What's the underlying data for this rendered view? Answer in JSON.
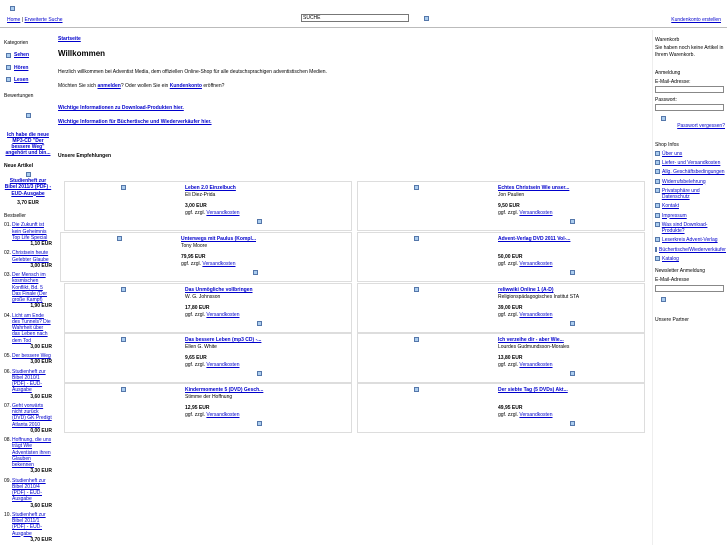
{
  "header": {
    "home": "Home",
    "advanced_search": "Erweiterte Suche",
    "search_value": "SUCHE",
    "customer_account": "Kundenkonto erstellen"
  },
  "left": {
    "categories_title": "Kategorien",
    "categories": [
      "Sehen",
      "Hören",
      "Lesen"
    ],
    "reviews_title": "Bewertungen",
    "review_text": "Ich habe die neue MP3-CD \"Der bessere Weg\" angehört und bin...",
    "new_title": "Neue Artikel",
    "new_item": "Studienheft zur Bibel 2011/3 (PDF) - EUD-Ausgabe",
    "new_price": "3,70 EUR",
    "bestseller_title": "Bestseller",
    "bestsellers": [
      {
        "num": "01.",
        "name": "Die Zukunft ist kein Geheimnis Top Life Special",
        "price": "1,10 EUR"
      },
      {
        "num": "02.",
        "name": "Christsein heute Gelebter Glaube",
        "price": "3,00 EUR"
      },
      {
        "num": "03.",
        "name": "Der Mensch im kosmischen Konflikt, Bd. 5 Das Finale (Der große Kampf)",
        "price": "1,90 EUR"
      },
      {
        "num": "04.",
        "name": "Licht am Ende des Tunnels? Die Wahrheit über das Leben nach dem Tod",
        "price": "3,00 EUR"
      },
      {
        "num": "05.",
        "name": "Der bessere Weg",
        "price": "3,00 EUR"
      },
      {
        "num": "06.",
        "name": "Studienheft zur Bibel 2010/1 (PDF) - EUD-Ausgabe",
        "price": "3,60 EUR"
      },
      {
        "num": "07.",
        "name": "Geht vorwärts nicht zurück (DVD) GK Predigt Atlanta 2010",
        "price": "0,00 EUR"
      },
      {
        "num": "08.",
        "name": "Hoffnung, die uns trägt Wie Adventisten ihren Glauben bekennen",
        "price": "3,30 EUR"
      },
      {
        "num": "09.",
        "name": "Studienheft zur Bibel 2010/4 (PDF) - EUD-Ausgabe",
        "price": "3,60 EUR"
      },
      {
        "num": "10.",
        "name": "Studienheft zur Bibel 2011/1 (PDF) - EUD-Ausgabe",
        "price": "3,70 EUR"
      }
    ]
  },
  "main": {
    "breadcrumb": "Startseite",
    "title": "Willkommen",
    "welcome": "Herzlich willkommen bei Adventist Media, dem offiziellen Online-Shop für alle deutschsprachigen adventistischen Medien.",
    "login_pre": "Möchten Sie sich",
    "login_link": "anmelden",
    "login_mid": "? Oder wollen Sie ein",
    "account_link": "Kundenkonto",
    "login_post": "eröffnen?",
    "info1": "Wichtige Informationen zu Download-Produkten hier.",
    "info2": "Wichtige Information für Büchertische und Wiederverkäufer hier.",
    "recs_title": "Unsere Empfehlungen",
    "shipping_pre": "ggf. zzgl.",
    "shipping_link": "Versandkosten",
    "products": [
      {
        "title": "Leben 2.0 Einzelbuch",
        "author": "Eli Diez-Prida",
        "price": "3,00 EUR"
      },
      {
        "title": "Echtes Christsein Wie unser...",
        "author": "Jon Paulien",
        "price": "9,50 EUR"
      },
      {
        "title": "Unterwegs mit Paulus (Kompl...",
        "author": "Tony Moore",
        "price": "79,95 EUR"
      },
      {
        "title": "Advent-Verlag DVD 2011 Vol-...",
        "author": "",
        "price": "50,00 EUR"
      },
      {
        "title": "Das Unmögliche vollbringen",
        "author": "W. G. Johnsson",
        "price": "17,80 EUR"
      },
      {
        "title": "reliwwiki Online 1 (A-D)",
        "author": "Religionspädagogisches Institut STA",
        "price": "39,00 EUR"
      },
      {
        "title": "Das bessere Leben (mp3 CD) -...",
        "author": "Ellen G. White",
        "price": "9,65 EUR"
      },
      {
        "title": "Ich verzeihe dir - aber Wie...",
        "author": "Lourdes Gudmundsson-Morales",
        "price": "13,80 EUR"
      },
      {
        "title": "Kindermomente 5 (DVD) Gesch...",
        "author": "Stimme der Hoffnung",
        "price": "12,95 EUR"
      },
      {
        "title": "Der siebte Tag (5 DVDs) Akt...",
        "author": "",
        "price": "49,95 EUR"
      }
    ]
  },
  "right": {
    "cart_title": "Warenkorb",
    "cart_empty": "Sie haben noch keine Artikel in Ihrem Warenkorb.",
    "login_title": "Anmeldung",
    "email_label": "E-Mail-Adresse:",
    "password_label": "Passwort:",
    "forgot": "Passwort vergessen?",
    "shopinfo_title": "Shop Infos",
    "shopinfo": [
      "Über uns",
      "Liefer- und Versandkosten",
      "Allg. Geschäftsbedingungen",
      "Widerrufsbelehrung",
      "Privatsphäre und Datenschutz",
      "Kontakt",
      "Impressum",
      "Was sind Download-Produkte?",
      "Leserkreis Advent-Verlag",
      "Büchertische/Wiederverkäufer",
      "Katalog"
    ],
    "newsletter_title": "Newsletter Anmeldung",
    "newsletter_email": "E-Mail-Adresse",
    "partners_title": "Unsere Partner"
  }
}
